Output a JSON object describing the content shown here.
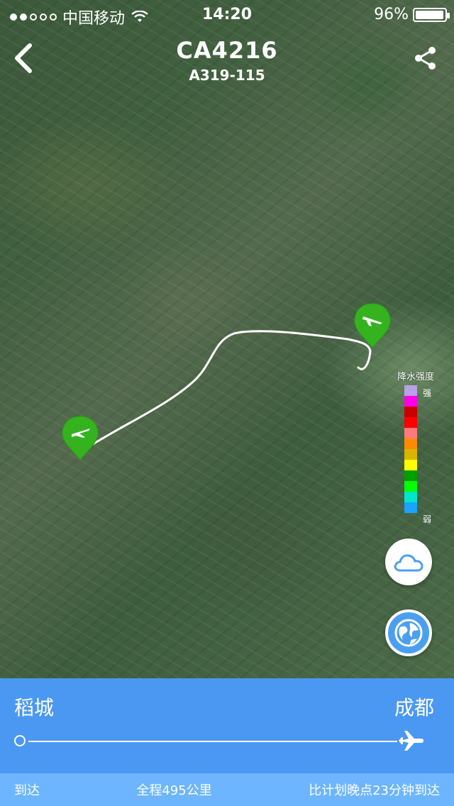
{
  "status_bar": {
    "carrier": "中国移动",
    "time": "14:20",
    "battery_percent": "96%",
    "battery_level": 0.96,
    "signal_bars_filled": 2,
    "signal_bars_total": 5
  },
  "header": {
    "flight_number": "CA4216",
    "aircraft": "A319-115",
    "back_icon": "chevron-left-icon",
    "share_icon": "share-icon"
  },
  "legend": {
    "title": "降水强度",
    "strong_label": "强",
    "weak_label": "弱",
    "colors": [
      "#b8a1e6",
      "#ff00e6",
      "#c80000",
      "#ff0000",
      "#ff7a7a",
      "#ff8a00",
      "#d9b500",
      "#ffff00",
      "#009e00",
      "#00ff00",
      "#00e6c8",
      "#1aa3ff"
    ]
  },
  "buttons": {
    "weather_icon": "cloud-icon",
    "globe_icon": "globe-icon"
  },
  "route": {
    "origin": "稻城",
    "destination": "成都",
    "progress": 1.0
  },
  "footer": {
    "status": "到达",
    "distance": "全程495公里",
    "delay": "比计划晚点23分钟到达"
  },
  "colors": {
    "panel_blue": "#4b98f2",
    "footer_blue": "#6db6ff",
    "pin_green": "#34b31f"
  }
}
